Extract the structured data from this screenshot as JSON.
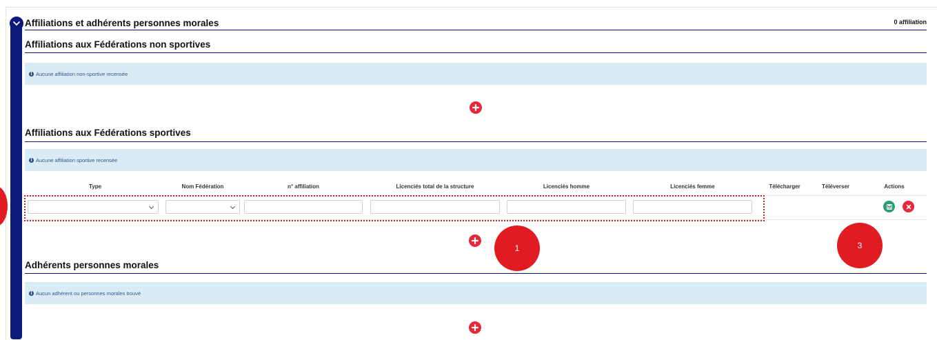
{
  "header": {
    "title": "Affiliations et adhérents personnes morales",
    "count": "0 affiliation"
  },
  "non_sport": {
    "title": "Affiliations aux Fédérations non sportives",
    "info": "Aucune affiliation non-sportive recensée"
  },
  "sport": {
    "title": "Affiliations aux Fédérations sportives",
    "info": "Aucune affiliation sportive recensée",
    "columns": [
      "Type",
      "Nom Fédération",
      "n° affiliation",
      "Licenciés total de la structure",
      "Licenciés homme",
      "Licenciés femme",
      "Télécharger",
      "Téléverser",
      "Actions"
    ]
  },
  "members": {
    "title": "Adhérents personnes morales",
    "info": "Aucun adhérent ou personnes morales trouvé"
  },
  "callouts": [
    "1",
    "3"
  ],
  "colors": {
    "accent": "#0d1a7a",
    "add": "#e8283a",
    "save": "#2e9b76",
    "delete": "#e8283a",
    "info_bg": "#d9ecf5",
    "annotation": "#e11b22"
  },
  "icons": [
    "chevron-down-icon",
    "info-icon",
    "plus-icon",
    "save-icon",
    "close-icon"
  ]
}
